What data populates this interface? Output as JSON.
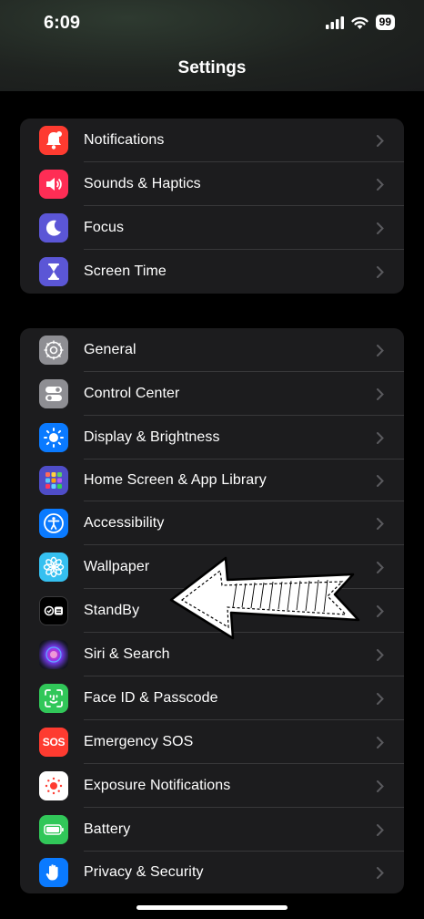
{
  "status_bar": {
    "time": "6:09",
    "battery_level": "99"
  },
  "nav": {
    "title": "Settings"
  },
  "colors": {
    "notifications": "#fe3b30",
    "sounds": "#fe2d55",
    "focus": "#5b56d6",
    "screen_time": "#5b56d6",
    "general": "#8e8e93",
    "control_center": "#8e8e93",
    "display": "#0a7aff",
    "home_screen": "#4f4dc8",
    "accessibility": "#0a7aff",
    "wallpaper": "#35c0f0",
    "standby": "#000000",
    "face_id": "#31c759",
    "emergency": "#fe3b30",
    "exposure": "#ffffff",
    "battery": "#31c759",
    "privacy": "#0a7aff"
  },
  "groups": [
    {
      "items": [
        {
          "label": "Notifications",
          "icon": "bell-icon"
        },
        {
          "label": "Sounds & Haptics",
          "icon": "speaker-icon"
        },
        {
          "label": "Focus",
          "icon": "moon-icon"
        },
        {
          "label": "Screen Time",
          "icon": "hourglass-icon"
        }
      ]
    },
    {
      "items": [
        {
          "label": "General",
          "icon": "gear-icon"
        },
        {
          "label": "Control Center",
          "icon": "toggles-icon"
        },
        {
          "label": "Display & Brightness",
          "icon": "sun-icon"
        },
        {
          "label": "Home Screen & App Library",
          "icon": "app-grid-icon"
        },
        {
          "label": "Accessibility",
          "icon": "accessibility-icon"
        },
        {
          "label": "Wallpaper",
          "icon": "flower-icon"
        },
        {
          "label": "StandBy",
          "icon": "standby-icon"
        },
        {
          "label": "Siri & Search",
          "icon": "siri-icon"
        },
        {
          "label": "Face ID & Passcode",
          "icon": "face-id-icon"
        },
        {
          "label": "Emergency SOS",
          "icon": "sos-icon",
          "icon_text": "SOS"
        },
        {
          "label": "Exposure Notifications",
          "icon": "exposure-icon"
        },
        {
          "label": "Battery",
          "icon": "battery-icon"
        },
        {
          "label": "Privacy & Security",
          "icon": "hand-icon"
        }
      ]
    }
  ]
}
